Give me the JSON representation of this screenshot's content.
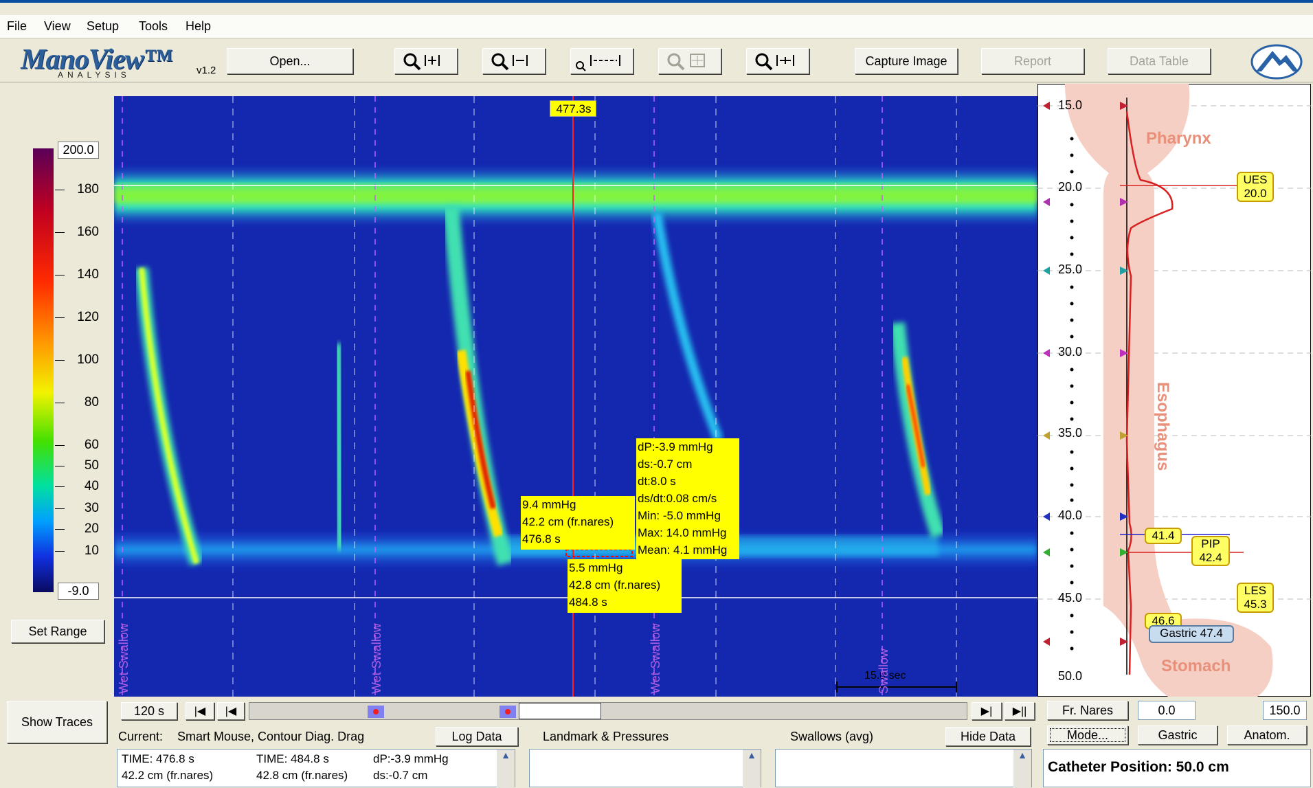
{
  "menu": [
    "File",
    "View",
    "Setup",
    "Tools",
    "Help"
  ],
  "logo": {
    "name": "ManoView™",
    "sub": "ANALYSIS",
    "version": "v1.2"
  },
  "toolbar": {
    "open": "Open...",
    "capture": "Capture Image",
    "report": "Report",
    "data_table": "Data Table"
  },
  "colorbar": {
    "max": "200.0",
    "min": "-9.0",
    "ticks": [
      "180",
      "160",
      "140",
      "120",
      "100",
      "80",
      "60",
      "50",
      "40",
      "30",
      "20",
      "10"
    ],
    "set_range": "Set Range"
  },
  "plot": {
    "cursor_time": "477.3s",
    "swallow_label": "Wet Swallow",
    "swallow_label_short": "Swallow",
    "scale_label": "15.0 sec",
    "box_left": [
      "9.4 mmHg",
      "42.2 cm (fr.nares)",
      "476.8 s"
    ],
    "box_right": [
      "dP:-3.9 mmHg",
      "ds:-0.7 cm",
      "dt:8.0 s",
      "ds/dt:0.08 cm/s",
      "Min: -5.0 mmHg",
      "Max: 14.0 mmHg",
      "Mean: 4.1 mmHg"
    ],
    "box_bottom": [
      "5.5 mmHg",
      "42.8 cm (fr.nares)",
      "484.8 s"
    ]
  },
  "anatomy": {
    "depths": [
      "15.0",
      "20.0",
      "25.0",
      "30.0",
      "35.0",
      "40.0",
      "45.0",
      "50.0"
    ],
    "pharynx": "Pharynx",
    "esophagus": "Esophagus",
    "stomach": "Stomach",
    "ues": [
      "UES",
      "20.0"
    ],
    "pip": [
      "PIP",
      "42.4"
    ],
    "les": [
      "LES",
      "45.3"
    ],
    "t414": "41.4",
    "t466": "46.6",
    "gastric": "Gastric 47.4"
  },
  "controls": {
    "show_traces": "Show Traces",
    "window": "120 s",
    "current_label": "Current:",
    "current_mode": "Smart Mouse, Contour Diag. Drag",
    "log_data": "Log Data",
    "landmark": "Landmark & Pressures",
    "swallows": "Swallows (avg)",
    "hide_data": "Hide Data",
    "fr_nares": "Fr. Nares",
    "fr_value": "0.0",
    "fr_max": "150.0",
    "mode": "Mode...",
    "gastric_btn": "Gastric",
    "anatom": "Anatom.",
    "catheter": "Catheter Position: 50.0 cm",
    "log_rows": [
      [
        "TIME: 476.8 s",
        "TIME: 484.8 s",
        "dP:-3.9 mmHg"
      ],
      [
        "42.2 cm (fr.nares)",
        "42.8 cm (fr.nares)",
        "ds:-0.7 cm"
      ]
    ]
  }
}
